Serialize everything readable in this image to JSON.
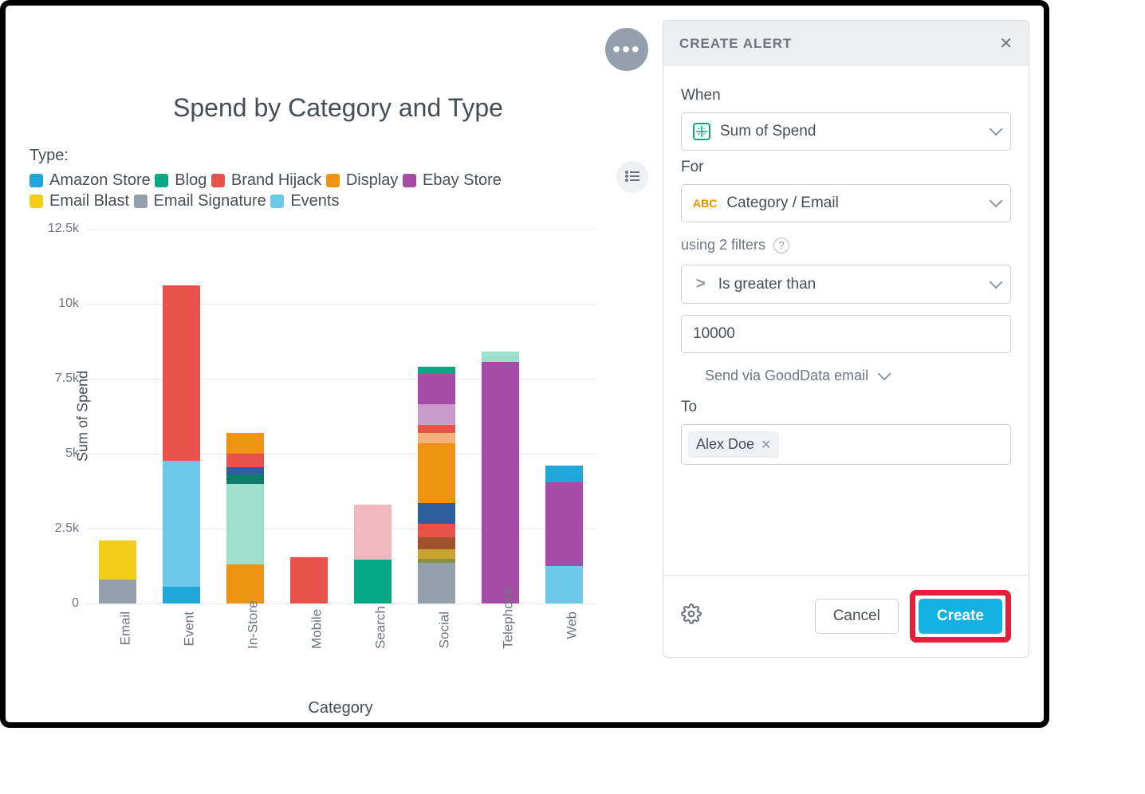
{
  "chart": {
    "title": "Spend by Category and Type",
    "legend_label": "Type:",
    "xlabel": "Category",
    "ylabel": "Sum of Spend"
  },
  "panel": {
    "title": "CREATE ALERT",
    "when_label": "When",
    "when_value": "Sum of Spend",
    "for_label": "For",
    "for_value": "Category / Email",
    "filters_text": "using 2 filters",
    "condition_value": "Is greater than",
    "threshold_value": "10000",
    "send_via": "Send via GoodData email",
    "to_label": "To",
    "recipient": "Alex Doe",
    "cancel": "Cancel",
    "create": "Create"
  },
  "chart_data": {
    "type": "bar",
    "stacked": true,
    "xlabel": "Category",
    "ylabel": "Sum of Spend",
    "title": "Spend by Category and Type",
    "y_ticks": [
      0,
      2500,
      5000,
      7500,
      10000,
      12500
    ],
    "y_tick_labels": [
      "0",
      "2.5k",
      "5k",
      "7.5k",
      "10k",
      "12.5k"
    ],
    "ylim": [
      0,
      12500
    ],
    "categories": [
      "Email",
      "Event",
      "In-Store",
      "Mobile",
      "Search",
      "Social",
      "Telephone",
      "Web"
    ],
    "legend": [
      {
        "name": "Amazon Store",
        "color": "#20A7DA"
      },
      {
        "name": "Blog",
        "color": "#05A882"
      },
      {
        "name": "Brand Hijack",
        "color": "#E9524B"
      },
      {
        "name": "Display",
        "color": "#EE9214"
      },
      {
        "name": "Ebay Store",
        "color": "#A64CA6"
      },
      {
        "name": "Email Blast",
        "color": "#F2CE1A"
      },
      {
        "name": "Email Signature",
        "color": "#94A1AD"
      },
      {
        "name": "Events",
        "color": "#6DC7E7"
      }
    ],
    "extra_colors": {
      "mint": "#9FDDCC",
      "teal": "#0F7C6C",
      "navy": "#2C5F9B",
      "darkpurple": "#6B3E7E",
      "pink": "#F0B8BE",
      "peach": "#F2B27A",
      "brown": "#A0522D",
      "ochre": "#C8A42E",
      "olive": "#8A8F3F",
      "lightpurple": "#C79CCB"
    },
    "stacks": {
      "Email": [
        {
          "color": "#94A1AD",
          "value": 800
        },
        {
          "color": "#F2CE1A",
          "value": 1300
        }
      ],
      "Event": [
        {
          "color": "#20A7DA",
          "value": 550
        },
        {
          "color": "#6DC7E7",
          "value": 4200
        },
        {
          "color": "#E9524B",
          "value": 5850
        }
      ],
      "In-Store": [
        {
          "color": "#EE9214",
          "value": 1300
        },
        {
          "color": "#9FDDCC",
          "value": 2700
        },
        {
          "color": "#0F7C6C",
          "value": 300
        },
        {
          "color": "#2C5F9B",
          "value": 250
        },
        {
          "color": "#E9524B",
          "value": 450
        },
        {
          "color": "#EE9214",
          "value": 700
        }
      ],
      "Mobile": [
        {
          "color": "#E9524B",
          "value": 1550
        }
      ],
      "Search": [
        {
          "color": "#05A882",
          "value": 1450
        },
        {
          "color": "#F0B8BE",
          "value": 1850
        }
      ],
      "Social": [
        {
          "color": "#94A1AD",
          "value": 1350
        },
        {
          "color": "#8A8F3F",
          "value": 150
        },
        {
          "color": "#C8A42E",
          "value": 300
        },
        {
          "color": "#A0522D",
          "value": 400
        },
        {
          "color": "#E9524B",
          "value": 450
        },
        {
          "color": "#2C5F9B",
          "value": 700
        },
        {
          "color": "#EE9214",
          "value": 2000
        },
        {
          "color": "#F2B27A",
          "value": 350
        },
        {
          "color": "#E9524B",
          "value": 250
        },
        {
          "color": "#C79CCB",
          "value": 700
        },
        {
          "color": "#A64CA6",
          "value": 1000
        },
        {
          "color": "#05A882",
          "value": 250
        }
      ],
      "Telephone": [
        {
          "color": "#A64CA6",
          "value": 8050
        },
        {
          "color": "#9FDDCC",
          "value": 350
        }
      ],
      "Web": [
        {
          "color": "#6DC7E7",
          "value": 1250
        },
        {
          "color": "#A64CA6",
          "value": 2800
        },
        {
          "color": "#20A7DA",
          "value": 550
        }
      ]
    }
  }
}
